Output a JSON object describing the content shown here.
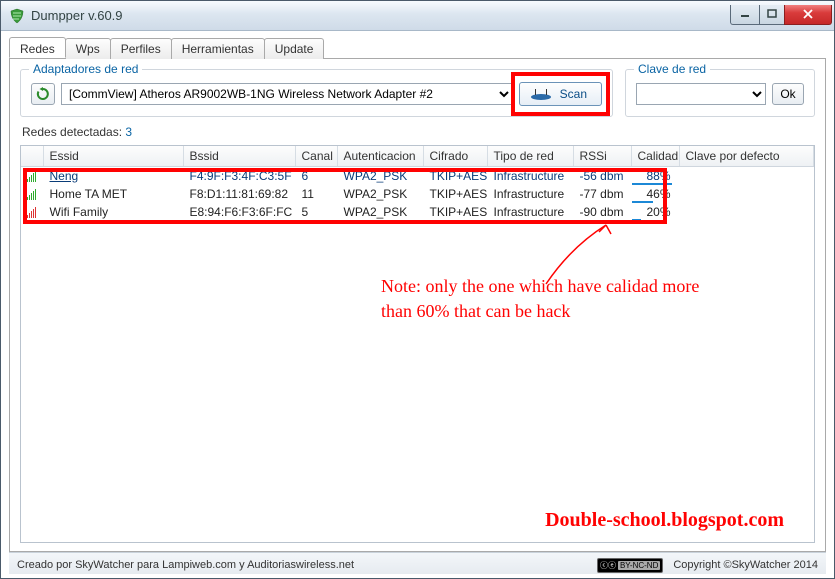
{
  "window": {
    "title": "Dumpper v.60.9"
  },
  "tabs": [
    "Redes",
    "Wps",
    "Perfiles",
    "Herramientas",
    "Update"
  ],
  "activeTab": 0,
  "adapters": {
    "legend": "Adaptadores de red",
    "selected": "[CommView] Atheros AR9002WB-1NG Wireless Network Adapter #2",
    "scan_label": "Scan"
  },
  "key": {
    "legend": "Clave de red",
    "ok_label": "Ok",
    "value": ""
  },
  "detected": {
    "label": "Redes detectadas:",
    "count": "3"
  },
  "columns": {
    "essid": "Essid",
    "bssid": "Bssid",
    "canal": "Canal",
    "auth": "Autenticacion",
    "cif": "Cifrado",
    "tipo": "Tipo de red",
    "rssi": "RSSi",
    "cal": "Calidad",
    "key": "Clave por defecto"
  },
  "rows": [
    {
      "sigColor": "green",
      "essid": "Neng",
      "bssid": "F4:9F:F3:4F:C3:5F",
      "canal": "6",
      "auth": "WPA2_PSK",
      "cif": "TKIP+AES",
      "tipo": "Infrastructure",
      "rssi": "-56 dbm",
      "cal": "88%",
      "calv": 88,
      "selected": true
    },
    {
      "sigColor": "green",
      "essid": "Home TA MET",
      "bssid": "F8:D1:11:81:69:82",
      "canal": "11",
      "auth": "WPA2_PSK",
      "cif": "TKIP+AES",
      "tipo": "Infrastructure",
      "rssi": "-77 dbm",
      "cal": "46%",
      "calv": 46,
      "selected": false
    },
    {
      "sigColor": "red",
      "essid": "Wifi Family",
      "bssid": "E8:94:F6:F3:6F:FC",
      "canal": "5",
      "auth": "WPA2_PSK",
      "cif": "TKIP+AES",
      "tipo": "Infrastructure",
      "rssi": "-90 dbm",
      "cal": "20%",
      "calv": 20,
      "selected": false
    }
  ],
  "annotation": "Note: only the one which have calidad more than 60% that can be hack",
  "watermark": "Double-school.blogspot.com",
  "footer": {
    "credit": "Creado por SkyWatcher para Lampiweb.com y Auditoriaswireless.net",
    "copyright": "Copyright ©SkyWatcher 2014",
    "cc": "BY-NC-ND"
  }
}
